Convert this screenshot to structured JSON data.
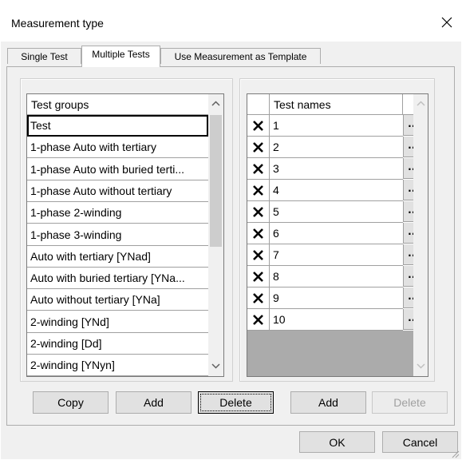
{
  "dialog": {
    "title": "Measurement type"
  },
  "tabs": [
    {
      "label": "Single Test",
      "active": false
    },
    {
      "label": "Multiple Tests",
      "active": true
    },
    {
      "label": "Use Measurement as Template",
      "active": false
    }
  ],
  "test_groups": {
    "header": "Test groups",
    "items": [
      "Test",
      "1-phase Auto with tertiary",
      "1-phase Auto with buried terti...",
      "1-phase Auto without tertiary",
      "1-phase 2-winding",
      "1-phase 3-winding",
      "Auto with tertiary [YNad]",
      "Auto with buried tertiary [YNa...",
      "Auto without tertiary [YNa]",
      "2-winding [YNd]",
      "2-winding [Dd]",
      "2-winding [YNyn]"
    ],
    "selected_index": 0
  },
  "test_names": {
    "header": "Test names",
    "items": [
      "1",
      "2",
      "3",
      "4",
      "5",
      "6",
      "7",
      "8",
      "9",
      "10"
    ],
    "ellipsis": "..."
  },
  "buttons": {
    "copy": "Copy",
    "add_group": "Add",
    "delete_group": "Delete",
    "add_test": "Add",
    "delete_test": "Delete",
    "ok": "OK",
    "cancel": "Cancel"
  }
}
